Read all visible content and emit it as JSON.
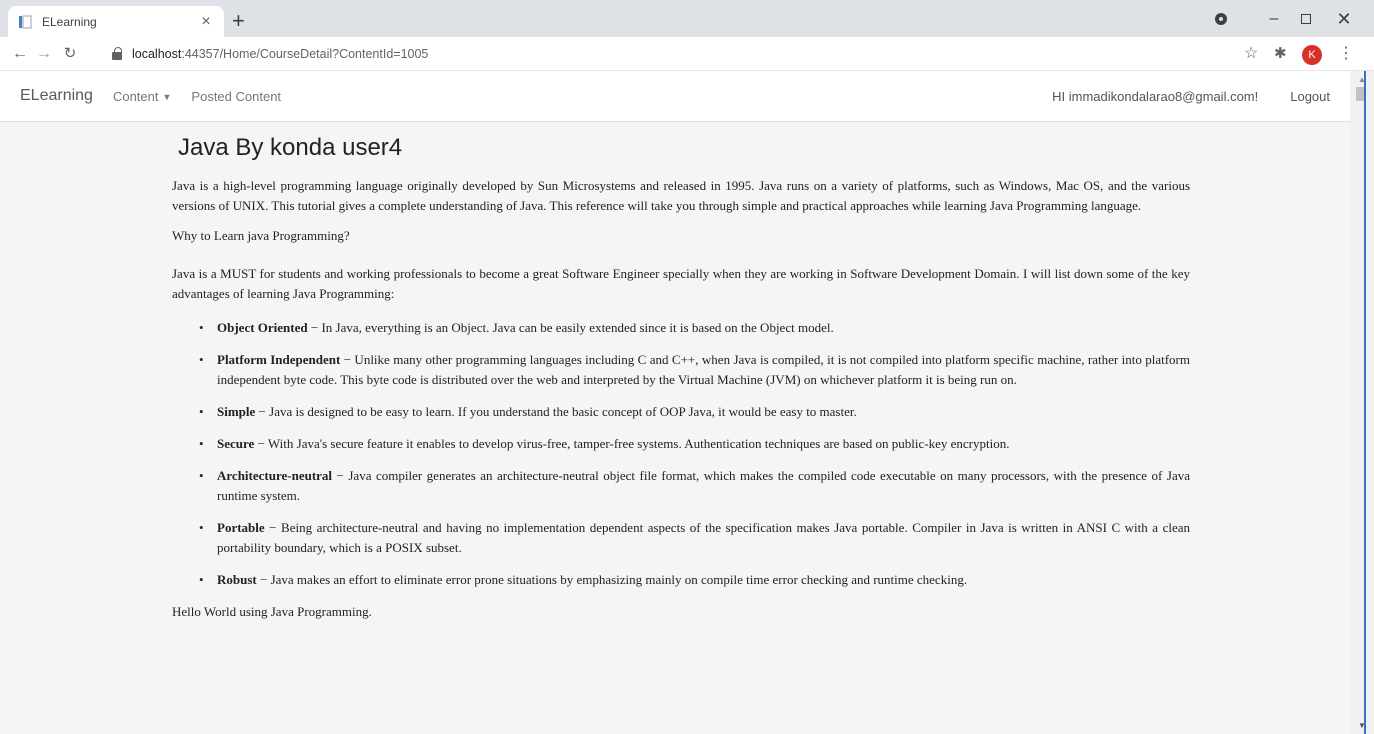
{
  "browser": {
    "tab_title": "ELearning",
    "tab_close": "×",
    "new_tab": "+",
    "url_host": "localhost",
    "url_rest": ":44357/Home/CourseDetail?ContentId=1005",
    "profile_initial": "K",
    "minimize": "–",
    "close": "✕"
  },
  "navbar": {
    "brand": "ELearning",
    "content_menu": "Content",
    "posted_content": "Posted Content",
    "greeting": "HI immadikondalarao8@gmail.com!",
    "logout": "Logout"
  },
  "course": {
    "title": "Java By konda user4",
    "intro": "Java is a high-level programming language originally developed by Sun Microsystems and released in 1995. Java runs on a variety of platforms, such as Windows, Mac OS, and the various versions of UNIX. This tutorial gives a complete understanding of Java. This reference will take you through simple and practical approaches while learning Java Programming language.",
    "why_heading": "Why to Learn java Programming?",
    "why_text": "Java is a MUST for students and working professionals to become a great Software Engineer specially when they are working in Software Development Domain. I will list down some of the key advantages of learning Java Programming:",
    "features": [
      {
        "name": "Object Oriented",
        "text": " − In Java, everything is an Object. Java can be easily extended since it is based on the Object model."
      },
      {
        "name": "Platform Independent",
        "text": " − Unlike many other programming languages including C and C++, when Java is compiled, it is not compiled into platform specific machine, rather into platform independent byte code. This byte code is distributed over the web and interpreted by the Virtual Machine (JVM) on whichever platform it is being run on."
      },
      {
        "name": "Simple",
        "text": " − Java is designed to be easy to learn. If you understand the basic concept of OOP Java, it would be easy to master."
      },
      {
        "name": "Secure",
        "text": " − With Java's secure feature it enables to develop virus-free, tamper-free systems. Authentication techniques are based on public-key encryption."
      },
      {
        "name": "Architecture-neutral",
        "text": " − Java compiler generates an architecture-neutral object file format, which makes the compiled code executable on many processors, with the presence of Java runtime system."
      },
      {
        "name": "Portable",
        "text": " − Being architecture-neutral and having no implementation dependent aspects of the specification makes Java portable. Compiler in Java is written in ANSI C with a clean portability boundary, which is a POSIX subset."
      },
      {
        "name": "Robust",
        "text": " − Java makes an effort to eliminate error prone situations by emphasizing mainly on compile time error checking and runtime checking."
      }
    ],
    "closing": "Hello World using Java Programming."
  },
  "icons": {
    "favicon": "page-icon",
    "back": "arrow-left-icon",
    "forward": "arrow-right-icon",
    "reload": "reload-icon",
    "lock": "lock-icon",
    "star": "star-icon",
    "extensions": "puzzle-icon",
    "menu": "kebab-menu-icon"
  },
  "colors": {
    "profile": "#d93025",
    "content_background": "#f5f5f5",
    "tabstrip": "#dee1e6"
  }
}
